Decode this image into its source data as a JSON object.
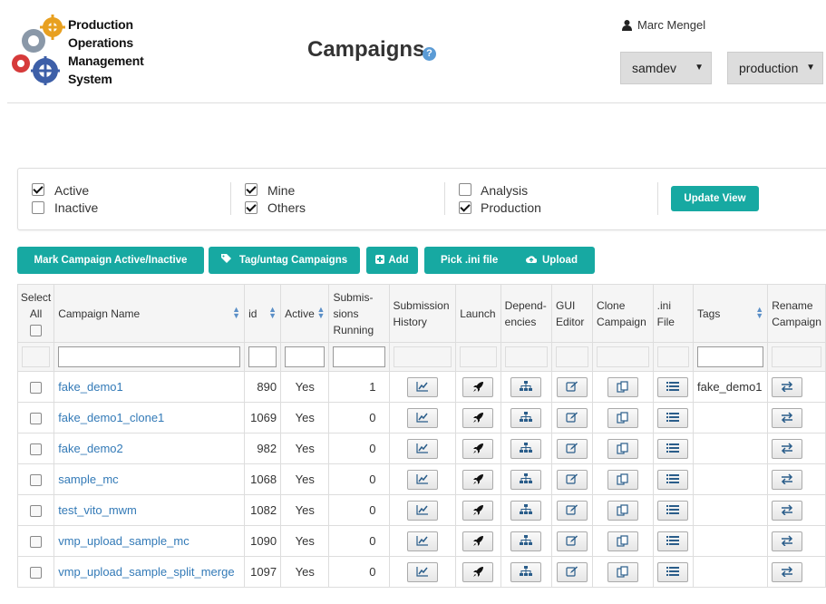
{
  "header": {
    "logo_lines": [
      "Production",
      "Operations",
      "Management",
      "System"
    ],
    "title": "Campaigns",
    "help_glyph": "?",
    "user_name": "Marc Mengel",
    "experiment_select": "samdev",
    "role_select": "production"
  },
  "filters": {
    "active": "Active",
    "active_checked": true,
    "inactive": "Inactive",
    "inactive_checked": false,
    "mine": "Mine",
    "mine_checked": true,
    "others": "Others",
    "others_checked": true,
    "analysis": "Analysis",
    "analysis_checked": false,
    "production": "Production",
    "production_checked": true,
    "update_view": "Update View"
  },
  "toolbar": {
    "mark_active": "Mark Campaign Active/Inactive",
    "tag_untag": "Tag/untag Campaigns",
    "add": "Add",
    "pick_ini": "Pick .ini file",
    "upload": "Upload"
  },
  "table": {
    "headers": {
      "select_all_1": "Select",
      "select_all_2": "All",
      "campaign_name": "Campaign Name",
      "id": "id",
      "active": "Active",
      "submissions_1": "Submis-",
      "submissions_2": "sions",
      "submissions_3": "Running",
      "history_1": "Submission",
      "history_2": "History",
      "launch": "Launch",
      "deps_1": "Depend-",
      "deps_2": "encies",
      "gui_1": "GUI",
      "gui_2": "Editor",
      "clone_1": "Clone",
      "clone_2": "Campaign",
      "ini_1": ".ini",
      "ini_2": "File",
      "tags": "Tags",
      "rename_1": "Rename",
      "rename_2": "Campaign"
    },
    "rows": [
      {
        "name": "fake_demo1",
        "id": "890",
        "active": "Yes",
        "running": "1",
        "tags": "fake_demo1"
      },
      {
        "name": "fake_demo1_clone1",
        "id": "1069",
        "active": "Yes",
        "running": "0",
        "tags": ""
      },
      {
        "name": "fake_demo2",
        "id": "982",
        "active": "Yes",
        "running": "0",
        "tags": ""
      },
      {
        "name": "sample_mc",
        "id": "1068",
        "active": "Yes",
        "running": "0",
        "tags": ""
      },
      {
        "name": "test_vito_mwm",
        "id": "1082",
        "active": "Yes",
        "running": "0",
        "tags": ""
      },
      {
        "name": "vmp_upload_sample_mc",
        "id": "1090",
        "active": "Yes",
        "running": "0",
        "tags": ""
      },
      {
        "name": "vmp_upload_sample_split_merge",
        "id": "1097",
        "active": "Yes",
        "running": "0",
        "tags": ""
      }
    ]
  },
  "colors": {
    "accent": "#17a9a2",
    "link": "#337ab7",
    "help": "#5b9bd5"
  },
  "icons": {
    "user": "user-icon",
    "history": "line-chart-icon",
    "launch": "rocket-icon",
    "dependencies": "sitemap-icon",
    "gui_editor": "edit-icon",
    "clone": "copy-icon",
    "ini": "list-icon",
    "rename": "exchange-icon",
    "tag": "tags-icon",
    "add": "plus-square-icon",
    "upload": "cloud-upload-icon"
  }
}
